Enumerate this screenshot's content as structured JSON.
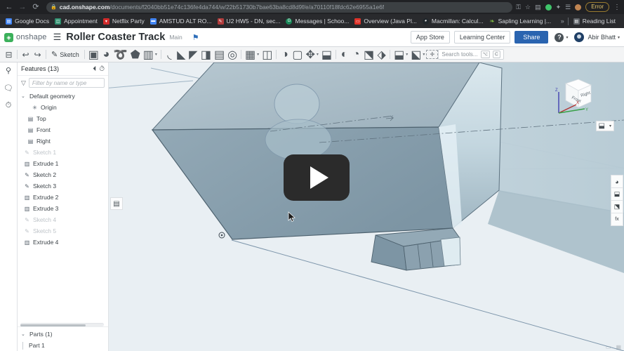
{
  "browser": {
    "nav": {
      "back": "←",
      "forward": "→",
      "reload": "⟳"
    },
    "lock_icon": "lock-icon",
    "url_host": "cad.onshape.com",
    "url_path": "/documents/f2040bb51e74c136fe4da744/w/22b51730b7bae63ba8cd8d9f/e/a70110f18fdc62e6955a1e6f",
    "toolbar_icons": [
      {
        "name": "key-icon",
        "glyph": "⚿"
      },
      {
        "name": "bookmark-star-icon",
        "glyph": "☆"
      },
      {
        "name": "save-page-icon",
        "glyph": "▤"
      },
      {
        "name": "extension-green-icon",
        "glyph": "●",
        "color": "#3fc46a"
      },
      {
        "name": "extensions-puzzle-icon",
        "glyph": "✦"
      },
      {
        "name": "reading-list-icon",
        "glyph": "☰"
      },
      {
        "name": "profile-avatar-icon",
        "glyph": "●",
        "color": "#c08552"
      }
    ],
    "error_badge": "Error",
    "menu_kebab": "⋮"
  },
  "bookmarks": {
    "items": [
      {
        "label": "Google Docs",
        "icon": "docs-icon",
        "color": "#4285f4",
        "glyph": "▤"
      },
      {
        "label": "Appointment",
        "icon": "appointment-icon",
        "color": "#2f8f6f",
        "glyph": "◫"
      },
      {
        "label": "Netflix Party",
        "icon": "netflix-party-icon",
        "color": "#d32b2b",
        "glyph": "▾"
      },
      {
        "label": "AMSTUD ALT RO...",
        "icon": "amstud-icon",
        "color": "#4285f4",
        "glyph": "▬"
      },
      {
        "label": "U2 HW5 - DN, sec...",
        "icon": "u2hw-icon",
        "color": "#b13c3c",
        "glyph": "✎"
      },
      {
        "label": "Messages | Schoo...",
        "icon": "messages-icon",
        "color": "#1a8a5a",
        "glyph": "G"
      },
      {
        "label": "Overview (Java Pl...",
        "icon": "java-overview-icon",
        "color": "#e0332a",
        "glyph": "▭"
      },
      {
        "label": "Macmillan: Calcul...",
        "icon": "macmillan-icon",
        "color": "#20262b",
        "glyph": "◕"
      },
      {
        "label": "Sapling Learning |...",
        "icon": "sapling-icon",
        "color": "#7cb342",
        "glyph": "❧"
      }
    ],
    "overflow": "»",
    "reading_list": {
      "label": "Reading List",
      "icon": "reading-list-icon",
      "glyph": "▤"
    }
  },
  "onshape_header": {
    "logo_text": "onshape",
    "logo_icon": "onshape-logo-icon",
    "menu_icon": "hamburger-menu-icon",
    "document_title": "Roller Coaster Track",
    "branch_label": "Main",
    "branch_icon": "branch-icon",
    "app_store_label": "App Store",
    "learning_center_label": "Learning Center",
    "share_label": "Share",
    "help_label": "?",
    "user_name": "Abir Bhatt",
    "caret": "▾"
  },
  "toolbar": {
    "left_groups": [
      [
        {
          "name": "feature-list-toggle-icon",
          "glyph": "⊟"
        }
      ],
      [
        {
          "name": "undo-icon",
          "glyph": "↩"
        },
        {
          "name": "redo-icon",
          "glyph": "↪"
        }
      ],
      [
        {
          "name": "sketch-icon",
          "glyph": "✎",
          "label": "Sketch"
        }
      ],
      [
        {
          "name": "plane-icon",
          "glyph": "▣"
        },
        {
          "name": "revolve-icon",
          "glyph": "◕"
        },
        {
          "name": "sweep-icon",
          "glyph": "➰"
        },
        {
          "name": "loft-icon",
          "glyph": "⬟"
        },
        {
          "name": "extrude-icon",
          "glyph": "▥",
          "caret": true
        }
      ],
      [
        {
          "name": "fillet-icon",
          "glyph": "◟"
        },
        {
          "name": "chamfer-icon",
          "glyph": "◣"
        },
        {
          "name": "draft-icon",
          "glyph": "◤"
        },
        {
          "name": "rib-icon",
          "glyph": "◨"
        },
        {
          "name": "shell-icon",
          "glyph": "▤"
        },
        {
          "name": "hole-icon",
          "glyph": "◎"
        }
      ],
      [
        {
          "name": "pattern-icon",
          "glyph": "▦",
          "caret": true
        },
        {
          "name": "mirror-icon",
          "glyph": "◫"
        }
      ],
      [
        {
          "name": "boolean-icon",
          "glyph": "◑"
        },
        {
          "name": "split-icon",
          "glyph": "▢"
        },
        {
          "name": "transform-icon",
          "glyph": "✥",
          "caret": true
        },
        {
          "name": "move-face-icon",
          "glyph": "⬓"
        }
      ],
      [
        {
          "name": "thicken-icon",
          "glyph": "◐"
        },
        {
          "name": "delete-face-icon",
          "glyph": "◔"
        },
        {
          "name": "enclose-icon",
          "glyph": "⬔"
        },
        {
          "name": "assembly-icon",
          "glyph": "⬗"
        }
      ],
      [
        {
          "name": "insert-part-icon",
          "glyph": "⬓",
          "caret": true
        },
        {
          "name": "derive-icon",
          "glyph": "⬕",
          "caret": true
        },
        {
          "name": "measure-icon",
          "glyph": "⊹"
        }
      ]
    ],
    "search_placeholder": "Search tools...",
    "search_shortcut_1": "⌥",
    "search_shortcut_2": "C"
  },
  "rail": {
    "icons": [
      {
        "name": "add-feature-icon",
        "glyph": "⚲"
      },
      {
        "name": "comment-icon",
        "glyph": "💬"
      },
      {
        "name": "history-icon",
        "glyph": "⏱"
      }
    ]
  },
  "feature_panel": {
    "title": "Features (13)",
    "header_icons": [
      {
        "name": "rollback-icon",
        "glyph": "⏴"
      },
      {
        "name": "feature-timer-icon",
        "glyph": "⏱"
      }
    ],
    "filter_icon": "filter-funnel-icon",
    "filter_placeholder": "Filter by name or type",
    "default_geometry": {
      "label": "Default geometry",
      "chevron": "⌄",
      "children": [
        {
          "label": "Origin",
          "icon": "origin-icon",
          "glyph": "✳",
          "dimmed": false
        },
        {
          "label": "Top",
          "icon": "plane-top-icon",
          "glyph": "▤",
          "dimmed": false
        },
        {
          "label": "Front",
          "icon": "plane-front-icon",
          "glyph": "▤",
          "dimmed": false
        },
        {
          "label": "Right",
          "icon": "plane-right-icon",
          "glyph": "▤",
          "dimmed": false
        }
      ]
    },
    "features": [
      {
        "label": "Sketch 1",
        "icon": "sketch-icon",
        "glyph": "✎",
        "dimmed": true
      },
      {
        "label": "Extrude 1",
        "icon": "extrude-icon",
        "glyph": "▥",
        "dimmed": false
      },
      {
        "label": "Sketch 2",
        "icon": "sketch-icon",
        "glyph": "✎",
        "dimmed": false
      },
      {
        "label": "Sketch 3",
        "icon": "sketch-icon",
        "glyph": "✎",
        "dimmed": false
      },
      {
        "label": "Extrude 2",
        "icon": "extrude-icon",
        "glyph": "▥",
        "dimmed": false
      },
      {
        "label": "Extrude 3",
        "icon": "extrude-icon",
        "glyph": "▥",
        "dimmed": false
      },
      {
        "label": "Sketch 4",
        "icon": "sketch-icon",
        "glyph": "✎",
        "dimmed": true
      },
      {
        "label": "Sketch 5",
        "icon": "sketch-icon",
        "glyph": "✎",
        "dimmed": true
      },
      {
        "label": "Extrude 4",
        "icon": "extrude-icon",
        "glyph": "▥",
        "dimmed": false
      }
    ],
    "parts": {
      "label": "Parts (1)",
      "chevron": "⌄",
      "items": [
        {
          "label": "Part 1"
        }
      ]
    }
  },
  "viewport": {
    "list_button_icon": "display-list-icon",
    "play_button": {
      "name": "video-play-button",
      "glyph": "▶"
    },
    "cursor_icon": "mouse-cursor-icon",
    "view_cube": {
      "front_label": "Front",
      "right_label": "Right",
      "axis_x": "X",
      "axis_y": "Y",
      "axis_z": "Z",
      "x_color": "#b03232",
      "y_color": "#37a047",
      "z_color": "#4040b0"
    },
    "view_menu": {
      "name": "view-orientation-icon",
      "glyph": "⬓",
      "caret": "▾"
    },
    "right_tools": [
      {
        "name": "display-style-icon",
        "glyph": "◕"
      },
      {
        "name": "section-view-icon",
        "glyph": "⬓"
      },
      {
        "name": "explode-view-icon",
        "glyph": "⬔"
      },
      {
        "name": "variable-icon",
        "glyph": "fx"
      }
    ],
    "bottom_right_icons": [
      {
        "name": "units-icon",
        "glyph": "▭"
      },
      {
        "name": "grid-icon",
        "glyph": "▦"
      }
    ],
    "model": {
      "body_color": "#8fa8b5",
      "top_face_color": "#a8bcc6",
      "highlight_color": "#cfe0e8",
      "background_color": "#e9eff3"
    }
  }
}
